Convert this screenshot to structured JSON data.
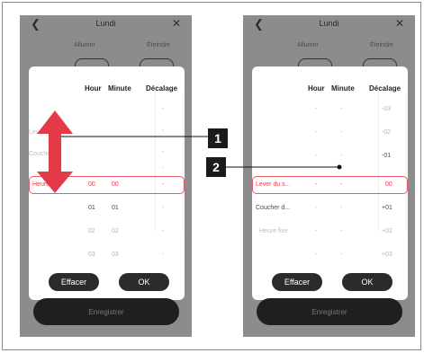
{
  "screen_title": "Lundi",
  "header": {
    "on_label": "Allumer",
    "off_label": "Éteindre"
  },
  "table": {
    "col_hour": "Hour",
    "col_minute": "Minute",
    "col_offset": "Décalage"
  },
  "left_phone": {
    "names": [
      "Lever du s...",
      "Coucher d...",
      "Heure fixe"
    ],
    "selected_hour": "00",
    "selected_minute": "00",
    "selected_offset": "-",
    "hours": [
      "01",
      "02",
      "03"
    ],
    "minutes": [
      "01",
      "02",
      "03"
    ],
    "offsets": [
      "-",
      "-",
      "-",
      "-",
      "-",
      "-",
      "-"
    ]
  },
  "right_phone": {
    "names": [
      "Lever du s...",
      "Coucher d...",
      "Heure fixe"
    ],
    "offsets_above": [
      "-03",
      "-02",
      "-01"
    ],
    "selected_offset": "00",
    "offsets_below": [
      "+01",
      "+02",
      "+03"
    ],
    "dash": "-"
  },
  "buttons": {
    "clear": "Effacer",
    "ok": "OK",
    "save": "Enregistrer"
  },
  "callouts": [
    "1",
    "2"
  ],
  "colors": {
    "highlight": "#e55b65",
    "arrow": "#e23b47",
    "selected_text": "#e23b47"
  }
}
